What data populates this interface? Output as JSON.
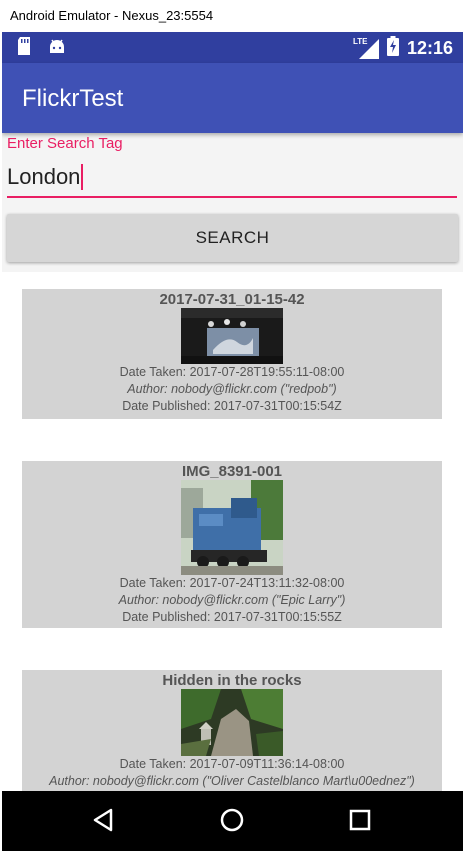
{
  "window": {
    "title": "Android Emulator - Nexus_23:5554"
  },
  "status_bar": {
    "time": "12:16",
    "network": "LTE"
  },
  "app_bar": {
    "title": "FlickrTest"
  },
  "search": {
    "label": "Enter Search Tag",
    "value": "London",
    "button_label": "SEARCH"
  },
  "results": [
    {
      "title": "2017-07-31_01-15-42",
      "date_taken": "Date Taken: 2017-07-28T19:55:11-08:00",
      "author": "Author: nobody@flickr.com (\"redpob\")",
      "date_published": "Date Published: 2017-07-31T00:15:54Z"
    },
    {
      "title": "IMG_8391-001",
      "date_taken": "Date Taken: 2017-07-24T13:11:32-08:00",
      "author": "Author: nobody@flickr.com (\"Epic Larry\")",
      "date_published": "Date Published: 2017-07-31T00:15:55Z"
    },
    {
      "title": "Hidden in the rocks",
      "date_taken": "Date Taken: 2017-07-09T11:36:14-08:00",
      "author": "Author: nobody@flickr.com (\"Oliver Castelblanco Mart\\u00ednez\")",
      "date_published": ""
    }
  ],
  "colors": {
    "status_bar": "#303f9f",
    "app_bar": "#3f51b5",
    "accent": "#e91e63",
    "card": "#d3d3d3"
  },
  "icons": [
    "sd-card-icon",
    "android-icon",
    "lte-signal-icon",
    "battery-charging-icon",
    "back-icon",
    "home-icon",
    "recents-icon"
  ]
}
